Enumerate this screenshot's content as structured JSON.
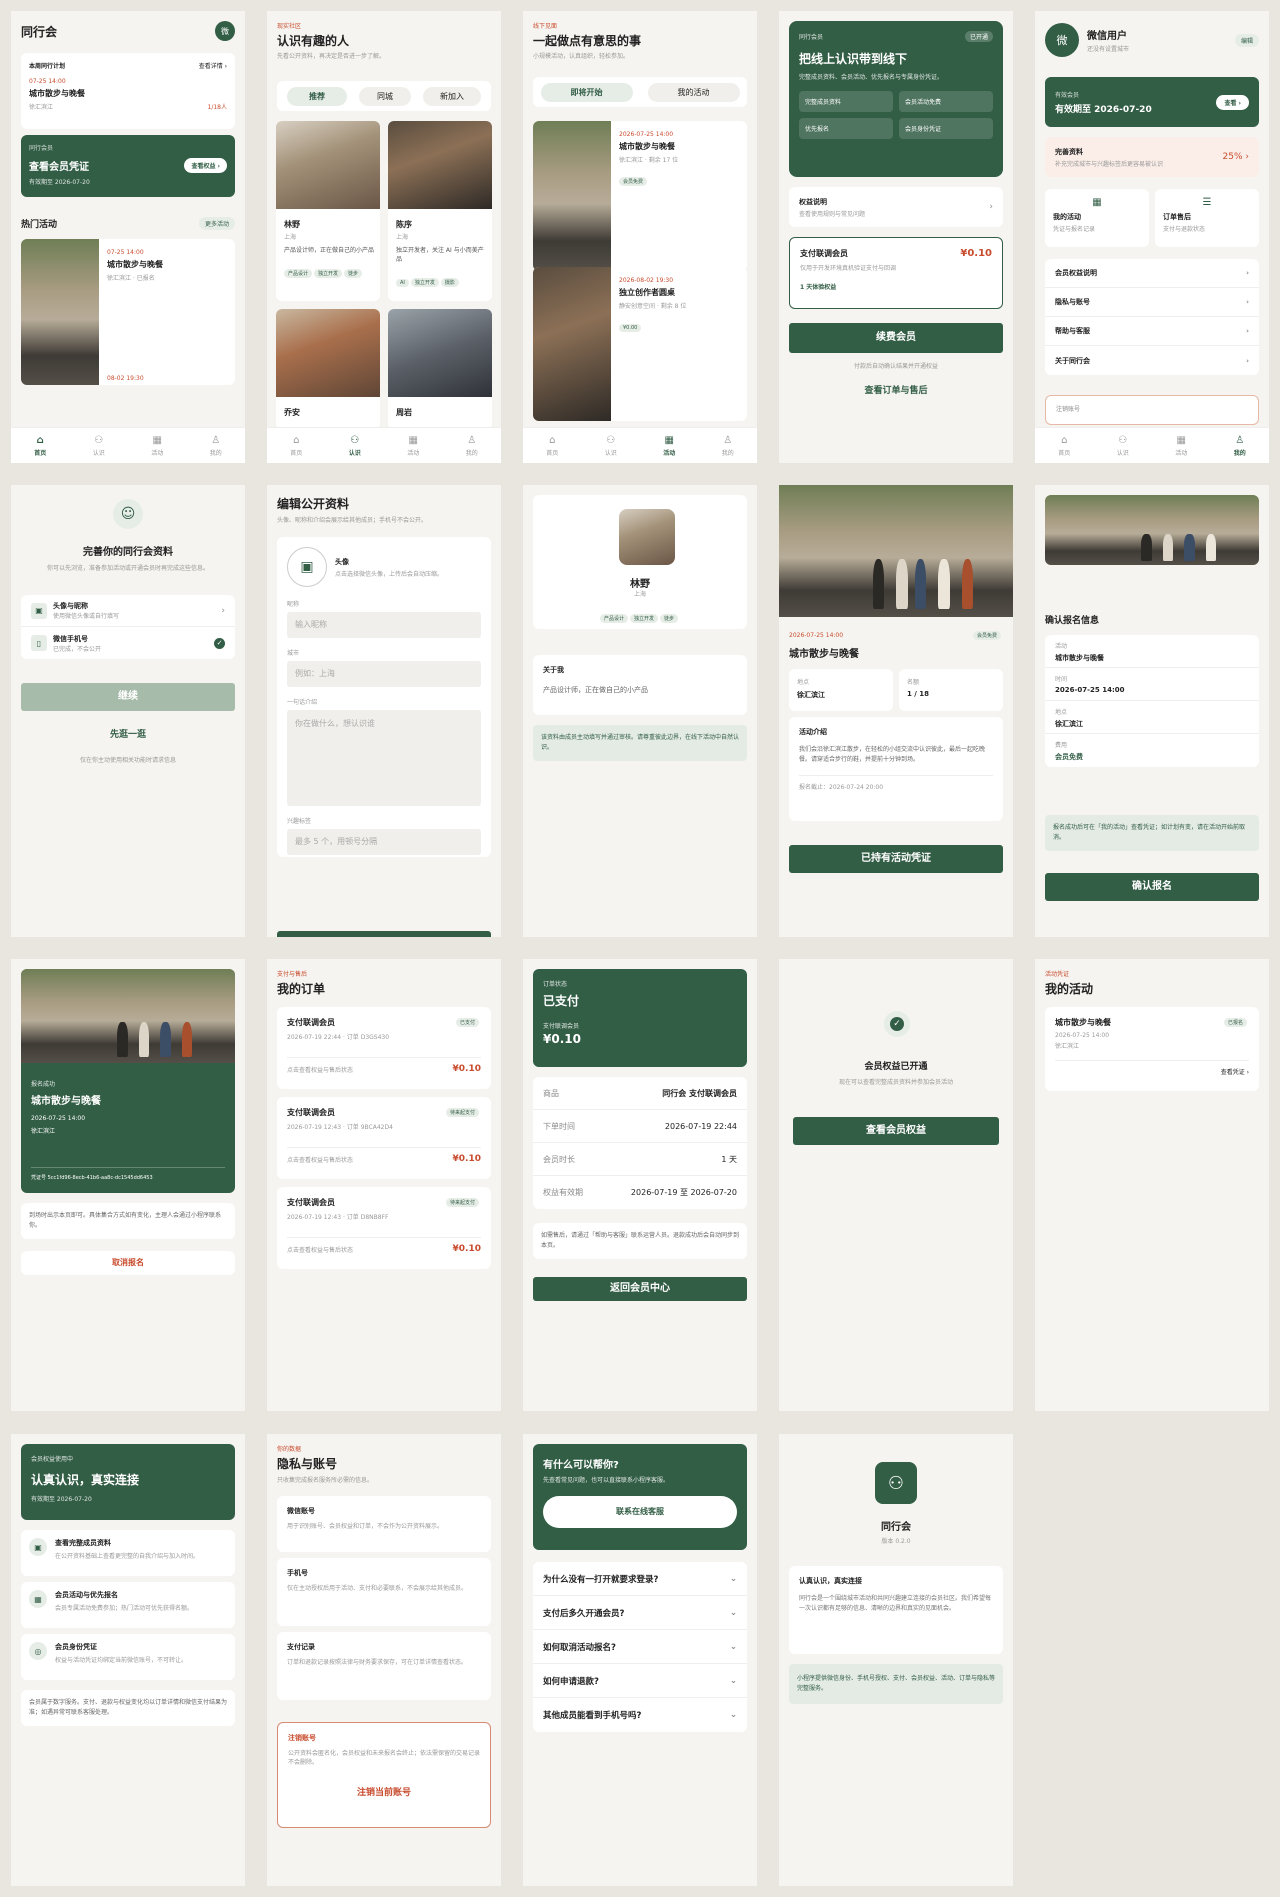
{
  "home": {
    "title": "同行会",
    "avatar": "微",
    "plan_label": "本周同行计划",
    "plan_link": "查看详情 ›",
    "plan_date": "07-25 14:00",
    "plan_title": "城市散步与晚餐",
    "plan_place": "徐汇滨江",
    "plan_count": "1/18人",
    "member_label": "同行会员",
    "member_title": "查看会员凭证",
    "member_expiry": "有效期至 2026-07-20",
    "member_btn": "查看权益 ›",
    "hot_title": "热门活动",
    "hot_more": "更多活动",
    "ev1_date": "07-25 14:00",
    "ev1_title": "城市散步与晚餐",
    "ev1_meta": "徐汇滨江 · 已报名",
    "ev2_date": "08-02 19:30"
  },
  "tabs": {
    "home": "首页",
    "meet": "认识",
    "events": "活动",
    "me": "我的"
  },
  "meet": {
    "eyebrow": "现实社区",
    "title": "认识有趣的人",
    "sub": "先看公开资料，再决定是否进一步了解。",
    "seg": [
      "推荐",
      "同城",
      "新加入"
    ],
    "p1_name": "林野",
    "p1_city": "上海",
    "p1_desc": "产品设计师，正在做自己的小产品",
    "p1_tags": [
      "产品设计",
      "独立开发",
      "徒步"
    ],
    "p2_name": "陈序",
    "p2_city": "上海",
    "p2_desc": "独立开发者，关注 AI 与小而美产品",
    "p2_tags": [
      "AI",
      "独立开发",
      "摄影"
    ],
    "p3_name": "乔安",
    "p4_name": "周岩"
  },
  "events": {
    "eyebrow": "线下见面",
    "title": "一起做点有意思的事",
    "sub": "小规模活动，认真组织，轻松参加。",
    "seg": [
      "即将开始",
      "我的活动"
    ],
    "e1_date": "2026-07-25 14:00",
    "e1_title": "城市散步与晚餐",
    "e1_meta": "徐汇滨江 · 剩余 17 位",
    "e1_tag": "会员免费",
    "e2_date": "2026-08-02 19:30",
    "e2_title": "独立创作者圆桌",
    "e2_meta": "静安创意空间 · 剩余 8 位",
    "e2_tag": "¥0.00"
  },
  "membership": {
    "label": "同行会员",
    "status": "已开通",
    "title": "把线上认识带到线下",
    "desc": "完整成员资料、会员活动、优先报名与专属身份凭证。",
    "benefits": [
      "完整成员资料",
      "会员活动免费",
      "优先报名",
      "会员身份凭证"
    ],
    "rights_title": "权益说明",
    "rights_sub": "查看使用规则与常见问题",
    "plan_title": "支付联调会员",
    "plan_price": "¥0.10",
    "plan_desc": "仅用于开发环境真机验证支付与回调",
    "plan_tag": "1 天体验权益",
    "renew_btn": "续费会员",
    "renew_note": "付款后自动确认结果并开通权益",
    "orders_link": "查看订单与售后"
  },
  "me": {
    "avatar": "微",
    "name": "微信用户",
    "sub": "还没有设置城市",
    "edit": "编辑",
    "member_label": "有效会员",
    "member_expiry": "有效期至 2026-07-20",
    "view": "查看 ›",
    "profile_label": "完善资料",
    "profile_sub": "补充完成城市与兴趣标签后更容易被认识",
    "profile_pct": "25% ›",
    "quick1": "我的活动",
    "quick1_sub": "凭证与报名记录",
    "quick2": "订单售后",
    "quick2_sub": "支付与退款状态",
    "menu": [
      "会员权益说明",
      "隐私与账号",
      "帮助与客服",
      "关于同行会"
    ],
    "more": "注销账号"
  },
  "onboard": {
    "title": "完善你的同行会资料",
    "sub": "你可以先浏览，准备参加活动或开通会员时再完成这些信息。",
    "item1": "头像与昵称",
    "item1_sub": "使用微信头像或自行填写",
    "item2": "微信手机号",
    "item2_sub": "已完成，不会公开",
    "continue": "继续",
    "skip": "先逛一逛",
    "note": "仅在你主动使用相关功能时请求信息"
  },
  "edit": {
    "title": "编辑公开资料",
    "sub": "头像、昵称和介绍会展示给其他成员；手机号不会公开。",
    "avatar_label": "头像",
    "avatar_sub": "点击选择微信头像，上传后会自动压缩。",
    "nick_label": "昵称",
    "nick_ph": "输入昵称",
    "city_label": "城市",
    "city_ph": "例如：上海",
    "bio_label": "一句话介绍",
    "bio_ph": "你在做什么，想认识谁",
    "tags_label": "兴趣标签",
    "tags_ph": "最多 5 个，用顿号分隔"
  },
  "profile": {
    "name": "林野",
    "city": "上海",
    "tags": [
      "产品设计",
      "独立开发",
      "徒步"
    ],
    "about_title": "关于我",
    "about_text": "产品设计师，正在做自己的小产品",
    "notice": "该资料由成员主动填写并通过审核。请尊重彼此边界，在线下活动中自然认识。"
  },
  "evdetail": {
    "date": "2026-07-25 14:00",
    "tag": "会员免费",
    "title": "城市散步与晚餐",
    "place_label": "地点",
    "place": "徐汇滨江",
    "count_label": "名额",
    "count": "1 / 18",
    "intro_title": "活动介绍",
    "intro": "我们会沿徐汇滨江散步，在轻松的小组交流中认识彼此，最后一起吃晚餐。请穿适合步行的鞋，并提前十分钟到场。",
    "deadline": "报名截止：2026-07-24 20:00",
    "btn": "已持有活动凭证"
  },
  "confirm": {
    "title": "确认报名信息",
    "f1_label": "活动",
    "f1": "城市散步与晚餐",
    "f2_label": "时间",
    "f2": "2026-07-25 14:00",
    "f3_label": "地点",
    "f3": "徐汇滨江",
    "f4_label": "费用",
    "f4": "会员免费",
    "note": "报名成功后可在「我的活动」查看凭证；如计划有变，请在活动开始前取消。",
    "btn": "确认报名"
  },
  "ticket": {
    "status": "报名成功",
    "title": "城市散步与晚餐",
    "date": "2026-07-25 14:00",
    "place": "徐汇滨江",
    "code": "凭证号 5cc1fd96-8ecb-41b6-aa8c-dc1545dd6453",
    "note": "到场时出示本页即可。具体集合方式如有变化，主理人会通过小程序联系你。",
    "cancel": "取消报名"
  },
  "orders": {
    "eyebrow": "支付与售后",
    "title": "我的订单",
    "list": [
      {
        "name": "支付联调会员",
        "status": "已支付",
        "meta": "2026-07-19 22:44 · 订单 D3GS430",
        "foot": "点击查看权益与售后状态",
        "price": "¥0.10"
      },
      {
        "name": "支付联调会员",
        "status": "待来起支付",
        "meta": "2026-07-19 12:43 · 订单 9BCA42D4",
        "foot": "点击查看权益与售后状态",
        "price": "¥0.10"
      },
      {
        "name": "支付联调会员",
        "status": "待来起支付",
        "meta": "2026-07-19 12:43 · 订单 D8NB8FF",
        "foot": "点击查看权益与售后状态",
        "price": "¥0.10"
      }
    ]
  },
  "orderdetail": {
    "label": "订单状态",
    "status": "已支付",
    "amount_label": "支付联调会员",
    "amount": "¥0.10",
    "rows": [
      {
        "k": "商品",
        "v": "同行会 支付联调会员"
      },
      {
        "k": "下单时间",
        "v": "2026-07-19 22:44"
      },
      {
        "k": "会员时长",
        "v": "1 天"
      },
      {
        "k": "权益有效期",
        "v": "2026-07-19 至 2026-07-20"
      }
    ],
    "note": "如需售后，请通过「帮助与客服」联系运营人员。退款成功后会自动同步到本页。",
    "btn": "返回会员中心"
  },
  "activated": {
    "title": "会员权益已开通",
    "sub": "现在可以查看完整成员资料并参加会员活动",
    "btn": "查看会员权益"
  },
  "myevents": {
    "eyebrow": "活动凭证",
    "title": "我的活动",
    "ev_title": "城市散步与晚餐",
    "ev_status": "已报名",
    "ev_date": "2026-07-25 14:00",
    "ev_place": "徐汇滨江",
    "ev_link": "查看凭证 ›"
  },
  "rights": {
    "label": "会员权益使用中",
    "title": "认真认识，真实连接",
    "expiry": "有效期至 2026-07-20",
    "items": [
      {
        "t": "查看完整成员资料",
        "d": "在公开资料基础上查看更完整的自我介绍与加入时间。"
      },
      {
        "t": "会员活动与优先报名",
        "d": "会员专属活动免费参加；热门活动可优先获得名额。"
      },
      {
        "t": "会员身份凭证",
        "d": "权益与活动凭证均绑定当前微信账号，不可转让。"
      }
    ],
    "note": "会员属于数字服务。支付、退款与权益变化均以订单详情和微信支付结果为准；如遇异常可联系客服处理。"
  },
  "privacy": {
    "eyebrow": "你的数据",
    "title": "隐私与账号",
    "sub": "只收集完成报名服务所必需的信息。",
    "s1": "微信账号",
    "s1d": "用于识别账号、会员权益和订单，不会作为公开资料展示。",
    "s2": "手机号",
    "s2d": "仅在主动授权后用于活动、支付和必要联系，不会展示给其他成员。",
    "s3": "支付记录",
    "s3d": "订单和退款记录按照法律与财务要求保存，可在订单详情查看状态。",
    "danger_title": "注销账号",
    "danger_d": "公开资料会匿名化，会员权益和未来报名会终止；依法需保留的交易记录不会删除。",
    "danger_btn": "注销当前账号"
  },
  "help": {
    "title": "有什么可以帮你?",
    "sub": "先查看常见问题，也可以直接联系小程序客服。",
    "btn": "联系在线客服",
    "faqs": [
      "为什么没有一打开就要求登录?",
      "支付后多久开通会员?",
      "如何取消活动报名?",
      "如何申请退款?",
      "其他成员能看到手机号吗?"
    ]
  },
  "about": {
    "name": "同行会",
    "version": "版本 0.2.0",
    "card_title": "认真认识，真实连接",
    "card_text": "同行会是一个围绕城市活动和共同兴趣建立连接的会员社区。我们希望每一次认识都有足够的信息、清晰的边界和真实的见面机会。",
    "note": "小程序提供微信身份、手机号授权、支付、会员权益、活动、订单与隐私等完整服务。"
  }
}
